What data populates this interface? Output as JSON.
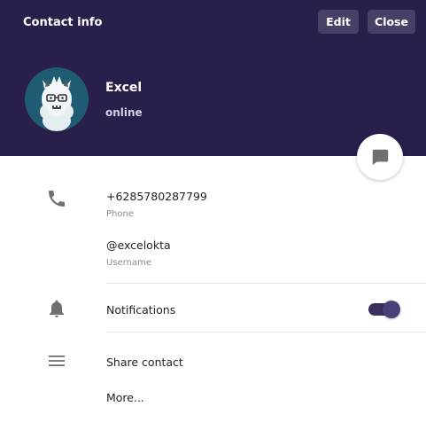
{
  "header": {
    "title": "Contact info",
    "edit_label": "Edit",
    "close_label": "Close",
    "background_color": "#2a1f4b"
  },
  "profile": {
    "name": "Excel",
    "status": "online",
    "avatar_icon": "yeti-avatar",
    "avatar_color": "#1f5c73"
  },
  "chat_button": {
    "icon": "chat-bubble-icon"
  },
  "details": {
    "phone": {
      "icon": "phone-icon",
      "value": "+6285780287799",
      "label": "Phone"
    },
    "username": {
      "value": "@excelokta",
      "label": "Username"
    }
  },
  "notifications": {
    "icon": "bell-icon",
    "label": "Notifications",
    "enabled": true,
    "toggle_color": "#3a2f5e"
  },
  "actions": {
    "icon": "menu-icon",
    "share_label": "Share contact",
    "more_label": "More..."
  }
}
